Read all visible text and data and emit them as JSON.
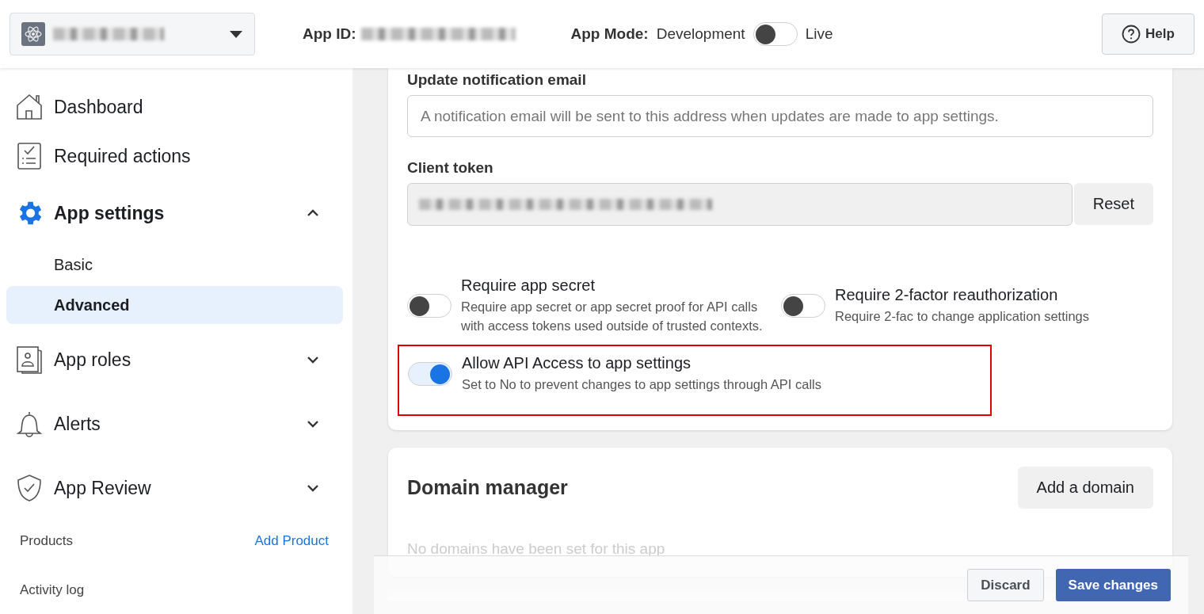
{
  "header": {
    "app_id_label": "App ID:",
    "app_mode_label": "App Mode:",
    "mode_off_label": "Development",
    "mode_toggle": {
      "on": false
    },
    "mode_on_label": "Live",
    "help": "Help"
  },
  "sidebar": {
    "items": [
      {
        "label": "Dashboard"
      },
      {
        "label": "Required actions"
      },
      {
        "label": "App settings",
        "expanded": true,
        "children": [
          {
            "label": "Basic",
            "selected": false
          },
          {
            "label": "Advanced",
            "selected": true
          }
        ]
      },
      {
        "label": "App roles",
        "expanded": false
      },
      {
        "label": "Alerts",
        "expanded": false
      },
      {
        "label": "App Review",
        "expanded": false
      }
    ],
    "products_label": "Products",
    "add_product": "Add Product",
    "activity_log": "Activity log"
  },
  "settings": {
    "email_label": "Update notification email",
    "email_placeholder": "A notification email will be sent to this address when updates are made to app settings.",
    "token_label": "Client token",
    "reset": "Reset",
    "toggles": [
      {
        "title": "Require app secret",
        "description": "Require app secret or app secret proof for API calls with access tokens used outside of trusted contexts.",
        "on": false,
        "highlighted": false
      },
      {
        "title": "Require 2-factor reauthorization",
        "description": "Require 2-fac to change application settings",
        "on": false,
        "highlighted": false
      },
      {
        "title": "Allow API Access to app settings",
        "description": "Set to No to prevent changes to app settings through API calls",
        "on": true,
        "highlighted": true
      }
    ]
  },
  "domain_manager": {
    "title": "Domain manager",
    "add": "Add a domain",
    "empty": "No domains have been set for this app"
  },
  "footer": {
    "discard": "Discard",
    "save": "Save changes"
  }
}
